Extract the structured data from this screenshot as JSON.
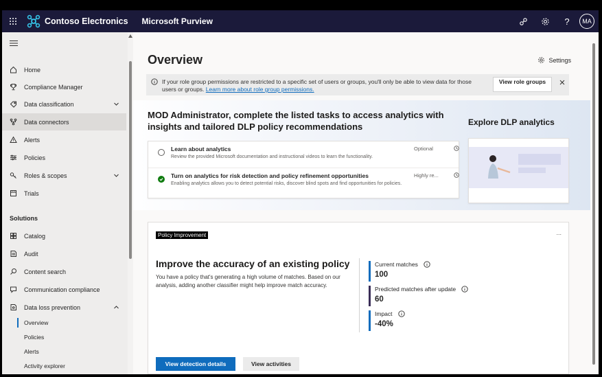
{
  "topbar": {
    "brand": "Contoso Electronics",
    "product": "Microsoft Purview",
    "avatar_initials": "MA",
    "bg_color": "#1b1a3a"
  },
  "sidebar": {
    "items": [
      {
        "label": "Home",
        "icon": "home-icon"
      },
      {
        "label": "Compliance Manager",
        "icon": "trophy-icon"
      },
      {
        "label": "Data classification",
        "icon": "tag-icon"
      },
      {
        "label": "Data connectors",
        "icon": "connector-icon"
      },
      {
        "label": "Alerts",
        "icon": "alert-icon"
      },
      {
        "label": "Policies",
        "icon": "policies-icon"
      },
      {
        "label": "Roles & scopes",
        "icon": "key-icon"
      },
      {
        "label": "Trials",
        "icon": "trials-icon"
      }
    ],
    "solutions_label": "Solutions",
    "solutions": [
      {
        "label": "Catalog",
        "icon": "catalog-icon"
      },
      {
        "label": "Audit",
        "icon": "audit-icon"
      },
      {
        "label": "Content search",
        "icon": "search-icon"
      },
      {
        "label": "Communication compliance",
        "icon": "chat-icon"
      },
      {
        "label": "Data loss prevention",
        "icon": "dlp-icon"
      }
    ],
    "dlp_sub": [
      {
        "label": "Overview"
      },
      {
        "label": "Policies"
      },
      {
        "label": "Alerts"
      },
      {
        "label": "Activity explorer"
      }
    ]
  },
  "main": {
    "title": "Overview",
    "settings_label": "Settings",
    "banner": {
      "text": "If your role group permissions are restricted to a specific set of users or groups, you'll only be able to view data for those users or groups.",
      "link": "Learn more about role group permissions.",
      "button": "View role groups"
    },
    "hero": {
      "title": "MOD Administrator, complete the listed tasks to access analytics with insights and tailored DLP policy recommendations",
      "tasks": [
        {
          "title": "Learn about analytics",
          "desc": "Review the provided Microsoft documentation and instructional videos to learn the functionality.",
          "tag": "Optional"
        },
        {
          "title": "Turn on analytics for risk detection and policy refinement opportunities",
          "desc": "Enabling analytics allows you to detect potential risks, discover blind spots and find opportunities for policies.",
          "tag": "Highly re..."
        }
      ],
      "explore_title": "Explore DLP analytics"
    },
    "policy": {
      "tag": "Policy Improvement",
      "more": "...",
      "title": "Improve the accuracy of an existing policy",
      "desc": "You have a policy that's generating a high volume of matches. Based on our analysis, adding another classifier might help improve match accuracy.",
      "metrics": [
        {
          "label": "Current matches",
          "value": "100",
          "color": "#0f6cbd"
        },
        {
          "label": "Predicted matches after update",
          "value": "60",
          "color": "#3b2e58"
        },
        {
          "label": "Impact",
          "value": "-40%",
          "color": "#0f6cbd"
        }
      ],
      "primary_button": "View detection details",
      "secondary_button": "View activities"
    }
  }
}
